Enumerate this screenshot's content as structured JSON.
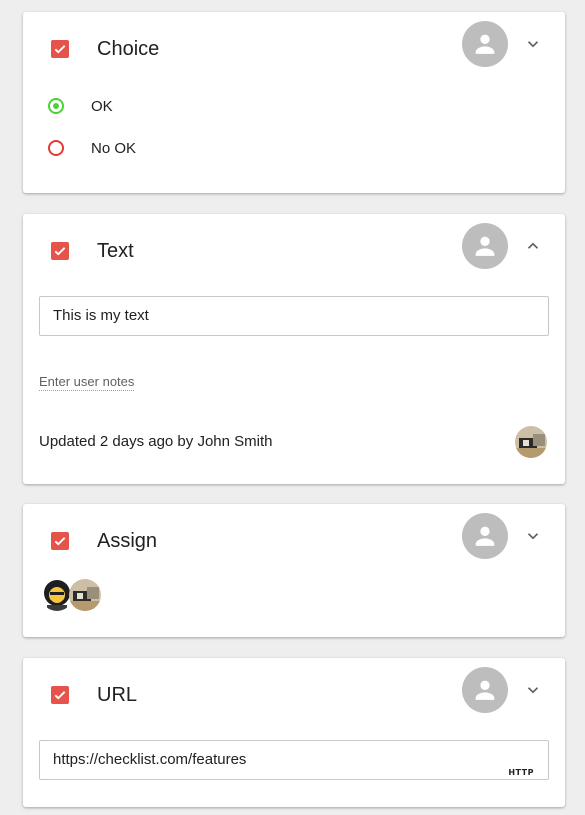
{
  "cards": {
    "choice": {
      "title": "Choice",
      "options": [
        {
          "label": "OK",
          "selected": true
        },
        {
          "label": "No OK",
          "selected": false
        }
      ],
      "expand_icon": "chevron-down-icon"
    },
    "text": {
      "title": "Text",
      "input_value": "This is my text",
      "notes_link": "Enter user notes",
      "updated": "Updated 2 days ago by John Smith",
      "expand_icon": "chevron-up-icon"
    },
    "assign": {
      "title": "Assign",
      "expand_icon": "chevron-down-icon"
    },
    "url": {
      "title": "URL",
      "input_value": "https://checklist.com/features",
      "tag": "HTTP",
      "expand_icon": "chevron-down-icon"
    }
  },
  "colors": {
    "checkbox": "#e5534b",
    "radio_selected": "#4cd137",
    "radio_unselected": "#e53935",
    "avatar_placeholder": "#bdbdbd"
  }
}
